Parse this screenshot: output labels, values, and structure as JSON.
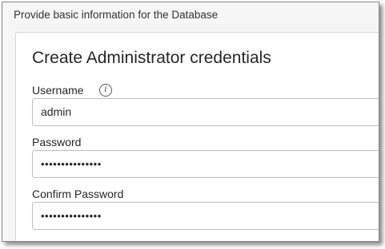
{
  "section": {
    "header": "Provide basic information for the Database"
  },
  "panel": {
    "title": "Create Administrator credentials",
    "username": {
      "label": "Username",
      "value": "admin",
      "info_icon": "info-icon"
    },
    "password": {
      "label": "Password",
      "value": "•••••••••••••••"
    },
    "confirm_password": {
      "label": "Confirm Password",
      "value": "•••••••••••••••"
    }
  }
}
